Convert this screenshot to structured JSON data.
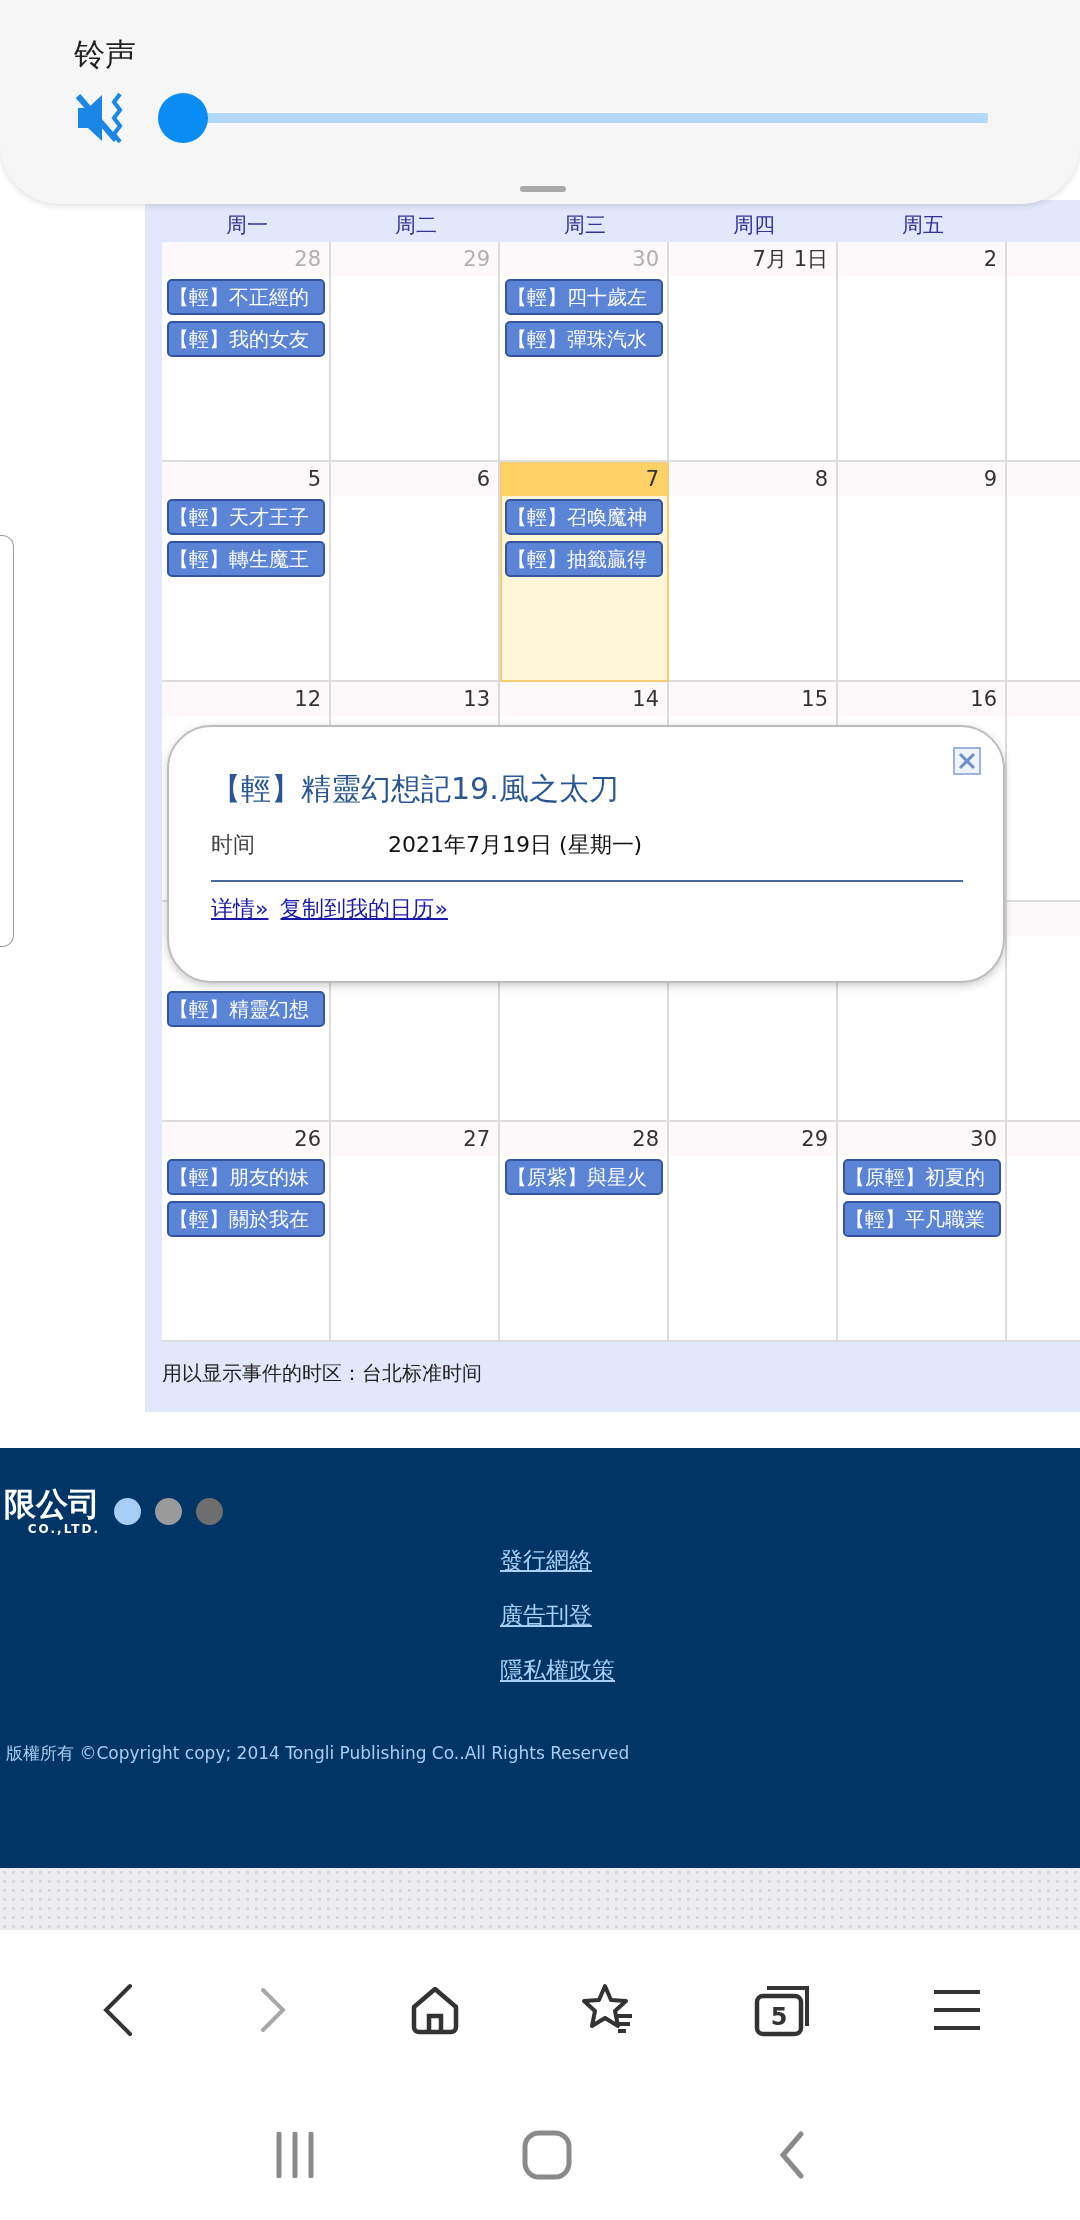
{
  "volume_panel": {
    "label": "铃声",
    "muted": true,
    "level": 0
  },
  "calendar": {
    "weekdays": [
      "周一",
      "周二",
      "周三",
      "周四",
      "周五"
    ],
    "weeks": [
      {
        "days": [
          {
            "date": "28",
            "other_month": true,
            "today": false,
            "events": [
              "【輕】不正經的",
              "【輕】我的女友"
            ]
          },
          {
            "date": "29",
            "other_month": true,
            "today": false
          },
          {
            "date": "30",
            "other_month": true,
            "today": false,
            "events": [
              "【輕】四十歲左",
              "【輕】彈珠汽水"
            ]
          },
          {
            "date": "7月 1日",
            "other_month": false,
            "today": false
          },
          {
            "date": "2",
            "other_month": false,
            "today": false
          }
        ]
      },
      {
        "days": [
          {
            "date": "5",
            "other_month": false,
            "today": false,
            "events": [
              "【輕】天才王子",
              "【輕】轉生魔王"
            ]
          },
          {
            "date": "6",
            "other_month": false,
            "today": false
          },
          {
            "date": "7",
            "other_month": false,
            "today": true,
            "events": [
              "【輕】召喚魔神",
              "【輕】抽籤贏得"
            ]
          },
          {
            "date": "8",
            "other_month": false,
            "today": false
          },
          {
            "date": "9",
            "other_month": false,
            "today": false
          }
        ]
      },
      {
        "days": [
          {
            "date": "12",
            "other_month": false,
            "today": false
          },
          {
            "date": "13",
            "other_month": false,
            "today": false
          },
          {
            "date": "14",
            "other_month": false,
            "today": false
          },
          {
            "date": "15",
            "other_month": false,
            "today": false
          },
          {
            "date": "16",
            "other_month": false,
            "today": false
          }
        ]
      },
      {
        "days": [
          {
            "today": false,
            "events": [
              "【輕】精靈幻想"
            ]
          },
          {
            "today": false
          },
          {
            "today": false
          },
          {
            "today": false
          },
          {
            "today": false
          }
        ]
      },
      {
        "days": [
          {
            "date": "26",
            "other_month": false,
            "today": false,
            "events": [
              "【輕】朋友的妹",
              "【輕】關於我在"
            ]
          },
          {
            "date": "27",
            "other_month": false,
            "today": false
          },
          {
            "date": "28",
            "other_month": false,
            "today": false,
            "events": [
              "【原紫】與星火"
            ]
          },
          {
            "date": "29",
            "other_month": false,
            "today": false
          },
          {
            "date": "30",
            "other_month": false,
            "today": false,
            "events": [
              "【原輕】初夏的",
              "【輕】平凡職業"
            ]
          }
        ]
      }
    ],
    "timezone_note": "用以显示事件的时区：台北标准时间"
  },
  "popup": {
    "title": "【輕】精靈幻想記19.風之太刀",
    "field_label": "时间",
    "field_value": "2021年7月19日 (星期一)",
    "links": [
      "详情»",
      "复制到我的日历»"
    ]
  },
  "footer": {
    "logo_text": "限公司",
    "logo_subtext": "CO.,LTD.",
    "dots": [
      {
        "color": "#a6cdf5"
      },
      {
        "color": "#9a9a9a"
      },
      {
        "color": "#6e6e6e"
      }
    ],
    "links": [
      "發行網絡",
      "廣告刊登",
      "隱私權政策"
    ],
    "copyright": "版權所有 ©Copyright copy; 2014 Tongli Publishing Co..All Rights Reserved"
  },
  "browser_toolbar": {
    "forward_disabled": true,
    "tab_count": "5"
  }
}
